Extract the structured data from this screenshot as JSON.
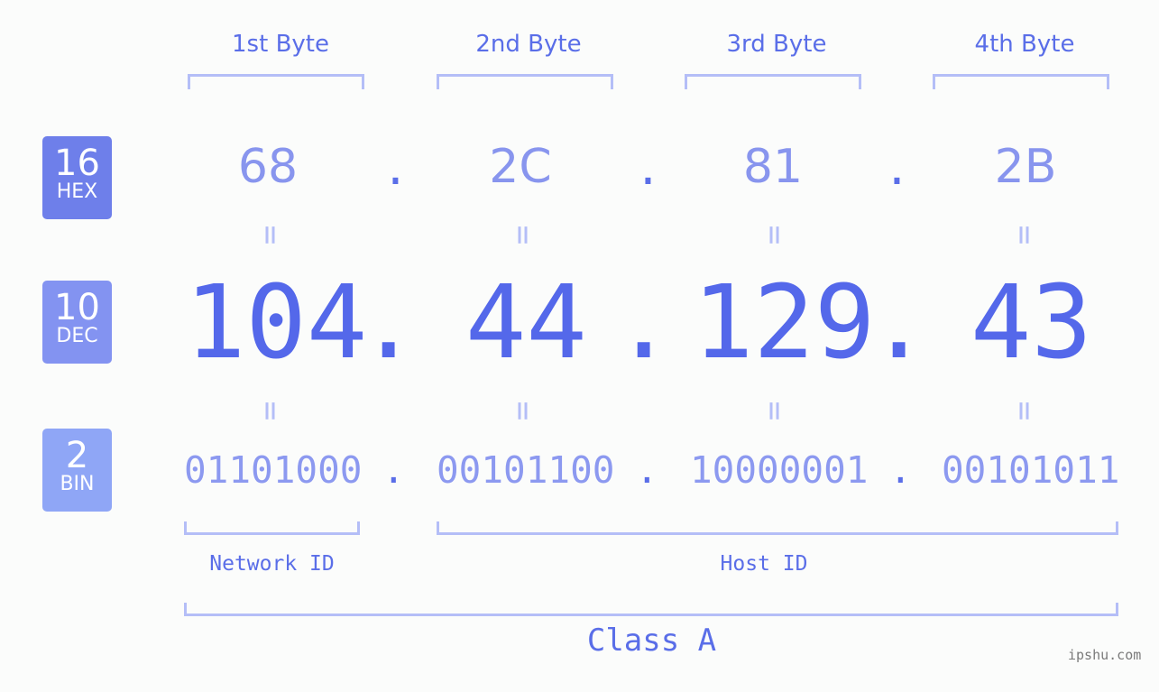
{
  "bases": [
    {
      "num": "16",
      "label": "HEX",
      "color": "#6e7fea"
    },
    {
      "num": "10",
      "label": "DEC",
      "color": "#8393f1"
    },
    {
      "num": "2",
      "label": "BIN",
      "color": "#8fa6f6"
    }
  ],
  "byte_labels": [
    "1st Byte",
    "2nd Byte",
    "3rd Byte",
    "4th Byte"
  ],
  "hex": [
    "68",
    "2C",
    "81",
    "2B"
  ],
  "dec": [
    "104",
    "44",
    "129",
    "43"
  ],
  "bin": [
    "01101000",
    "00101100",
    "10000001",
    "00101011"
  ],
  "separator": ".",
  "equals": "=",
  "network_id_label": "Network ID",
  "host_id_label": "Host ID",
  "class_label": "Class A",
  "watermark": "ipshu.com"
}
